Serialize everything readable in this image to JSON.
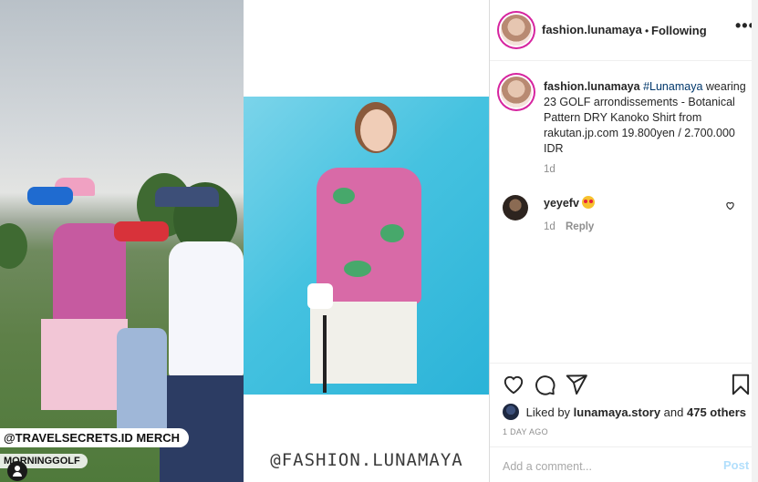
{
  "header": {
    "username": "fashion.lunamaya",
    "separator": "•",
    "follow_status": "Following",
    "more_label": "•••"
  },
  "caption": {
    "username": "fashion.lunamaya",
    "hashtag": "#Lunamaya",
    "text": "wearing 23 GOLF arrondissements - Botanical Pattern DRY Kanoko Shirt from rakutan.jp.com 19.800yen / 2.700.000 IDR",
    "time": "1d"
  },
  "comments": [
    {
      "username": "yeyefv",
      "text": "😍",
      "time": "1d",
      "reply_label": "Reply"
    }
  ],
  "actions": {
    "liked_by_prefix": "Liked by",
    "liked_by_user": "lunamaya.story",
    "liked_by_and": "and",
    "liked_by_others": "475 others",
    "posted_ago": "1 DAY AGO"
  },
  "add_comment": {
    "placeholder": "Add a comment...",
    "post_label": "Post"
  },
  "media": {
    "tag_primary": "@TRAVELSECRETS.ID MERCH",
    "tag_secondary": "MORNINGGOLF",
    "watermark": "@FASHION.LUNAMAYA"
  },
  "icons": [
    "heart-icon",
    "comment-icon",
    "share-icon",
    "bookmark-icon",
    "more-icon",
    "user-tag-icon"
  ],
  "colors": {
    "accent_link": "#00376b",
    "post_disabled": "#b2dffc",
    "muted": "#8e8e8e",
    "story_ring": "#d6249f",
    "photo_background": "#45c2e0"
  }
}
